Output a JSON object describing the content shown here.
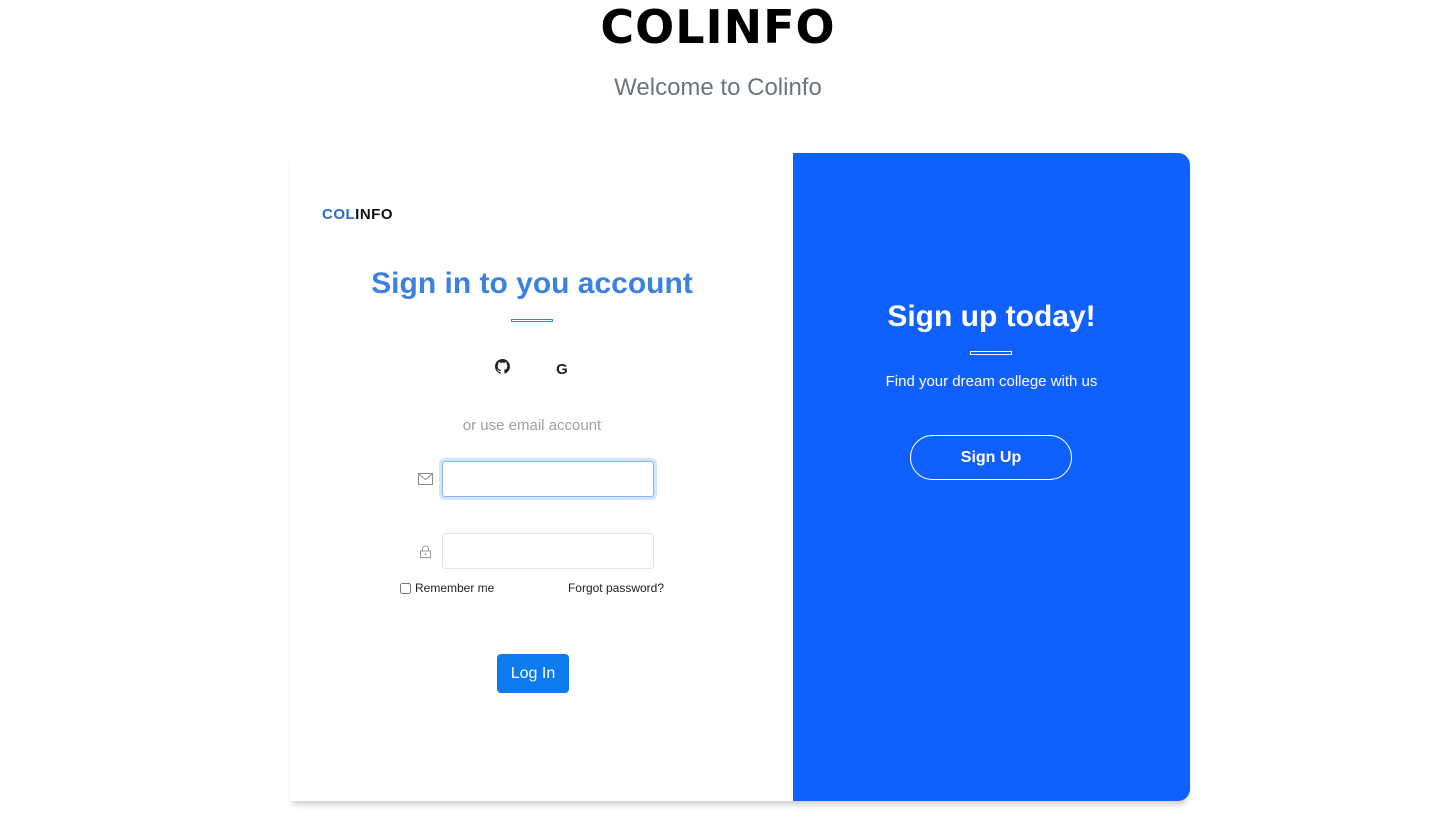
{
  "header": {
    "title": "COLINFO",
    "subtitle": "Welcome to Colinfo"
  },
  "brand": {
    "part1": "COL",
    "part2": "INFO"
  },
  "signin": {
    "title": "Sign in to you account",
    "social": [
      {
        "icon": "github-icon"
      },
      {
        "icon": "google-icon",
        "glyph": "G"
      }
    ],
    "or_text": "or use email account",
    "email": {
      "value": "",
      "placeholder": "",
      "icon": "envelope-icon"
    },
    "password": {
      "value": "",
      "placeholder": "",
      "icon": "lock-icon"
    },
    "remember_label": "Remember me",
    "forgot_label": "Forgot password?",
    "login_label": "Log In",
    "accent_color": "#3b82e0",
    "button_color": "#0d7bf0"
  },
  "signup": {
    "title": "Sign up today!",
    "subtitle": "Find your dream college with us",
    "button_label": "Sign Up",
    "panel_color": "#1060ff"
  }
}
